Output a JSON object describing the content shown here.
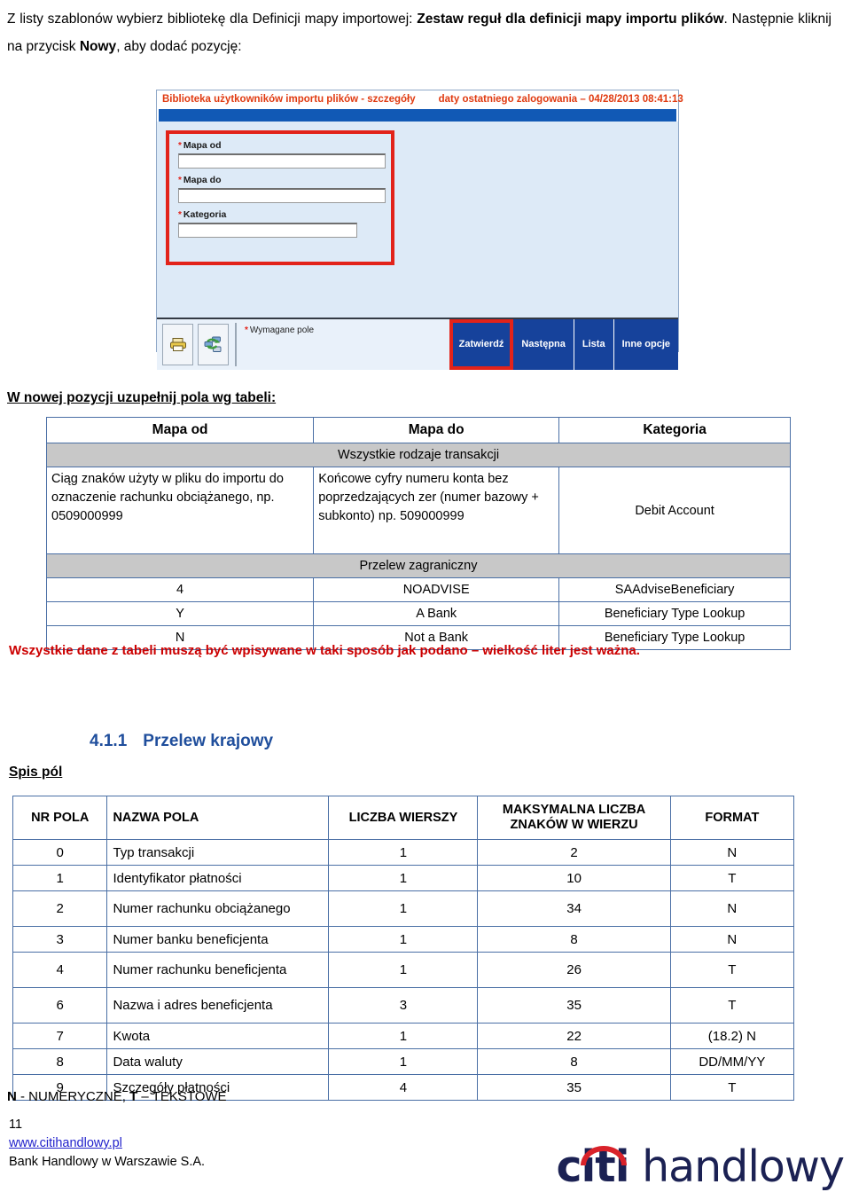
{
  "intro": {
    "part1": "Z listy szablonów wybierz bibliotekę dla Definicji mapy importowej: ",
    "bold1": "Zestaw reguł dla definicji mapy importu plików",
    "part2": ". Następnie kliknij na przycisk ",
    "bold2": "Nowy",
    "part3": ", aby dodać pozycję:"
  },
  "screenshot": {
    "title": "Biblioteka użytkowników importu plików - szczegóły",
    "last_login": "daty ostatniego zalogowania – 04/28/2013 08:41:13",
    "fields": [
      {
        "label": "Mapa od",
        "value": "",
        "required": true
      },
      {
        "label": "Mapa do",
        "value": "",
        "required": true
      },
      {
        "label": "Kategoria",
        "value": "",
        "required": true
      }
    ],
    "required_note": "Wymagane pole",
    "required_marker": "*",
    "icons": {
      "print": "printer-icon",
      "export": "network-export-icon"
    },
    "buttons": [
      {
        "label": "Zatwierdź",
        "highlighted": true
      },
      {
        "label": "Następna",
        "highlighted": false
      },
      {
        "label": "Lista",
        "highlighted": false
      },
      {
        "label": "Inne opcje",
        "highlighted": false
      }
    ],
    "colors": {
      "title": "#e03a10",
      "bluebar": "#1159b5",
      "button": "#16429b",
      "highlight": "#e2231a",
      "body": "#ddeaf7"
    }
  },
  "section_nowa_label": "W nowej pozycji uzupełnij pola wg tabeli:",
  "table1": {
    "headers": [
      "Mapa od",
      "Mapa do",
      "Kategoria"
    ],
    "band1": "Wszystkie rodzaje transakcji",
    "row_big": {
      "mapa_od": "Ciąg znaków użyty w pliku do importu do oznaczenie rachunku obciążanego, np. 0509000999",
      "mapa_do": "Końcowe cyfry numeru konta bez poprzedzających zer (numer bazowy + subkonto) np. 509000999",
      "kategoria": "Debit Account"
    },
    "band2": "Przelew zagraniczny",
    "rows": [
      [
        "4",
        "NOADVISE",
        "SAAdviseBeneficiary"
      ],
      [
        "Y",
        "A Bank",
        "Beneficiary Type Lookup"
      ],
      [
        "N",
        "Not a Bank",
        "Beneficiary Type Lookup"
      ]
    ]
  },
  "warning": "Wszystkie dane z tabeli muszą być wpisywane w taki sposób jak podano – wielkość liter jest ważna.",
  "heading": {
    "number": "4.1.1",
    "text": "Przelew krajowy"
  },
  "section_spis_label": "Spis pól",
  "table2": {
    "headers": [
      "NR POLA",
      "NAZWA POLA",
      "LICZBA WIERSZY",
      "MAKSYMALNA LICZBA ZNAKÓW W WIERZU",
      "FORMAT"
    ],
    "rows": [
      {
        "nr": "0",
        "nazwa": "Typ transakcji",
        "wierszy": "1",
        "znakow": "2",
        "format": "N",
        "tall": false
      },
      {
        "nr": "1",
        "nazwa": "Identyfikator płatności",
        "wierszy": "1",
        "znakow": "10",
        "format": "T",
        "tall": false
      },
      {
        "nr": "2",
        "nazwa": "Numer rachunku obciążanego",
        "wierszy": "1",
        "znakow": "34",
        "format": "N",
        "tall": true
      },
      {
        "nr": "3",
        "nazwa": "Numer banku beneficjenta",
        "wierszy": "1",
        "znakow": "8",
        "format": "N",
        "tall": false
      },
      {
        "nr": "4",
        "nazwa": "Numer rachunku beneficjenta",
        "wierszy": "1",
        "znakow": "26",
        "format": "T",
        "tall": true
      },
      {
        "nr": "6",
        "nazwa": "Nazwa i adres beneficjenta",
        "wierszy": "3",
        "znakow": "35",
        "format": "T",
        "tall": true
      },
      {
        "nr": "7",
        "nazwa": "Kwota",
        "wierszy": "1",
        "znakow": "22",
        "format": "(18.2)  N",
        "tall": false
      },
      {
        "nr": "8",
        "nazwa": "Data waluty",
        "wierszy": "1",
        "znakow": "8",
        "format": "DD/MM/YY",
        "tall": false
      },
      {
        "nr": "9",
        "nazwa": "Szczegóły płatności",
        "wierszy": "4",
        "znakow": "35",
        "format": "T",
        "tall": false
      }
    ]
  },
  "legend": {
    "n": "N",
    "n_text": " - NUMERYCZNE, ",
    "t": "T",
    "t_text": " – TEKSTOWE"
  },
  "footer": {
    "page_number": "11",
    "url": "www.citihandlowy.pl",
    "bank": "Bank Handlowy w Warszawie S.A."
  },
  "logo": {
    "citi": "citi",
    "handlowy": "handlowy",
    "arc_color": "#d9222a",
    "text_color": "#1b2153"
  }
}
